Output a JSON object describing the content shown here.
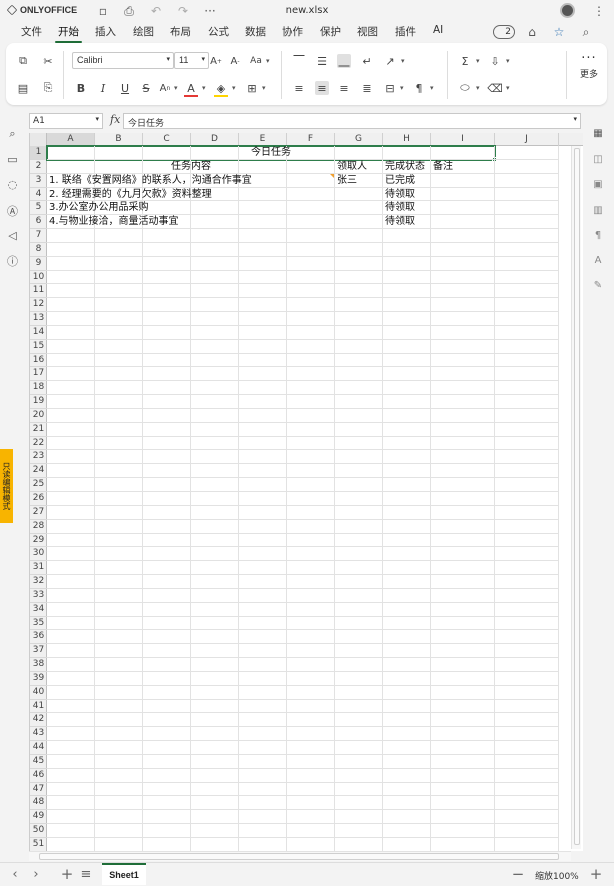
{
  "app": {
    "brand": "ONLYOFFICE",
    "file_name": "new.xlsx"
  },
  "menu": {
    "tabs": [
      "文件",
      "开始",
      "插入",
      "绘图",
      "布局",
      "公式",
      "数据",
      "协作",
      "保护",
      "视图",
      "插件",
      "AI"
    ],
    "active": "开始",
    "users_count": "2"
  },
  "ribbon": {
    "font_name": "Calibri",
    "font_size": "11",
    "more_label": "更多",
    "accent_color": "#1f6d38",
    "font_color_bar": "#e53935",
    "fill_color_bar": "#ffd400"
  },
  "formula_bar": {
    "cell_ref": "A1",
    "fx": "fx",
    "content": "今日任务"
  },
  "sidebar_plugin_label": "只读编辑模式",
  "sheet": {
    "columns": [
      "A",
      "B",
      "C",
      "D",
      "E",
      "F",
      "G",
      "H",
      "I",
      "J"
    ],
    "row_numbers": [
      "1",
      "2",
      "3",
      "4",
      "5",
      "6",
      "7",
      "8",
      "9",
      "10",
      "11",
      "12",
      "13",
      "14",
      "15",
      "16",
      "17",
      "18",
      "19",
      "20",
      "21",
      "22",
      "23",
      "24",
      "25",
      "26",
      "27",
      "28",
      "29",
      "30",
      "31",
      "32",
      "33",
      "34",
      "35",
      "36",
      "37",
      "38",
      "39",
      "40",
      "41",
      "42",
      "43",
      "44",
      "45",
      "46",
      "47",
      "48",
      "49",
      "50",
      "51"
    ],
    "selected_cell": "A1",
    "cells": {
      "A1": "今日任务",
      "A2": "任务内容",
      "G2": "领取人",
      "H2": "完成状态",
      "I2": "备注",
      "A3": "1. 联络《安置网络》的联系人，沟通合作事宜",
      "G3": "张三",
      "H3": "已完成",
      "A4": "2. 经理需要的《九月欠款》资料整理",
      "H4": "待领取",
      "A5": "3.办公室办公用品采购",
      "H5": "待领取",
      "A6": "4.与物业接洽，商量活动事宜",
      "H6": "待领取"
    }
  },
  "sheet_tabs": {
    "active": "Sheet1",
    "zoom": "缩放100%"
  }
}
